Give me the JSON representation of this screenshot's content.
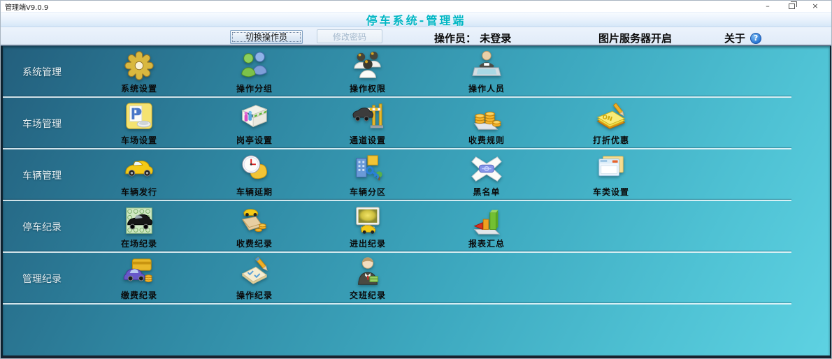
{
  "window": {
    "title": "管理端V9.0.9",
    "controls": {
      "minimize": "–",
      "close": "×"
    }
  },
  "header": {
    "title": "停车系统-管理端"
  },
  "toolbar": {
    "switch_operator": "切换操作员",
    "change_password": "修改密码",
    "operator_status": "操作员： 未登录",
    "image_server_status": "图片服务器开启",
    "about_label": "关于",
    "help_glyph": "?"
  },
  "colors": {
    "header_title": "#00b6c4",
    "main_gradient_top": "#235f7d",
    "main_gradient_bottom": "#5ed2e2",
    "divider": "#eef6f8",
    "item_label": "#0a0a0a"
  },
  "menu": {
    "rows": [
      {
        "category": "系统管理",
        "items": [
          {
            "id": "system-settings",
            "label": "系统设置",
            "icon": "gear"
          },
          {
            "id": "operator-groups",
            "label": "操作分组",
            "icon": "group"
          },
          {
            "id": "operator-permissions",
            "label": "操作权限",
            "icon": "perms"
          },
          {
            "id": "operator-staff",
            "label": "操作人员",
            "icon": "operator"
          }
        ]
      },
      {
        "category": "车场管理",
        "items": [
          {
            "id": "parking-lot-settings",
            "label": "车场设置",
            "icon": "parking"
          },
          {
            "id": "booth-settings",
            "label": "岗亭设置",
            "icon": "booth"
          },
          {
            "id": "channel-settings",
            "label": "通道设置",
            "icon": "gate"
          },
          {
            "id": "fee-rules",
            "label": "收费规则",
            "icon": "coins"
          },
          {
            "id": "discount-offers",
            "label": "打折优惠",
            "icon": "discount"
          }
        ]
      },
      {
        "category": "车辆管理",
        "items": [
          {
            "id": "vehicle-issue",
            "label": "车辆发行",
            "icon": "car"
          },
          {
            "id": "vehicle-extension",
            "label": "车辆延期",
            "icon": "clock"
          },
          {
            "id": "vehicle-partition",
            "label": "车辆分区",
            "icon": "partition"
          },
          {
            "id": "blacklist",
            "label": "黑名单",
            "icon": "blacklist"
          },
          {
            "id": "vehicle-class",
            "label": "车类设置",
            "icon": "cards"
          }
        ]
      },
      {
        "category": "停车纪录",
        "items": [
          {
            "id": "onsite-records",
            "label": "在场纪录",
            "icon": "onsite"
          },
          {
            "id": "charge-records",
            "label": "收费纪录",
            "icon": "wallet"
          },
          {
            "id": "inout-records",
            "label": "进出纪录",
            "icon": "monitor"
          },
          {
            "id": "report-summary",
            "label": "报表汇总",
            "icon": "chart"
          }
        ]
      },
      {
        "category": "管理纪录",
        "items": [
          {
            "id": "payment-records",
            "label": "缴费纪录",
            "icon": "payment"
          },
          {
            "id": "operation-records",
            "label": "操作纪录",
            "icon": "oplog"
          },
          {
            "id": "shift-records",
            "label": "交班纪录",
            "icon": "shift"
          }
        ]
      }
    ]
  }
}
